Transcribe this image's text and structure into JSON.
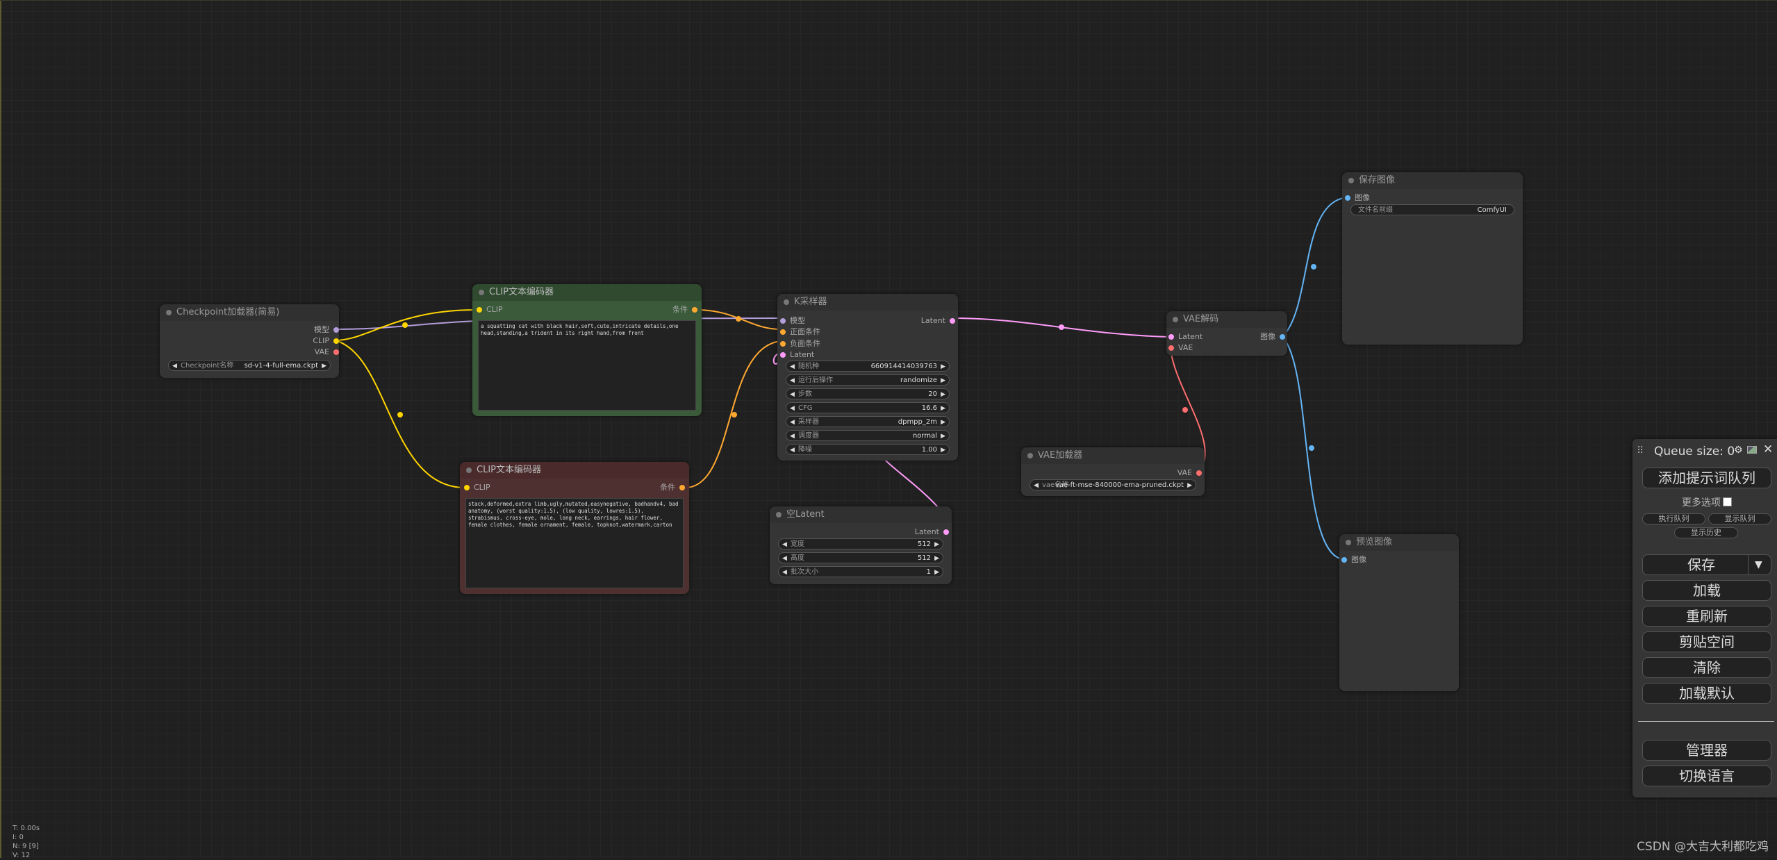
{
  "nodes": {
    "checkpoint": {
      "title": "Checkpoint加载器(简易)",
      "outputs": [
        "模型",
        "CLIP",
        "VAE"
      ],
      "widget_label": "Checkpoint名称",
      "widget_value": "sd-v1-4-full-ema.ckpt"
    },
    "clip_pos": {
      "title": "CLIP文本编码器",
      "input": "CLIP",
      "output": "条件",
      "text": "a squatting cat with black hair,soft,cute,intricate details,one head,standing,a trident in its right hand,from front"
    },
    "clip_neg": {
      "title": "CLIP文本编码器",
      "input": "CLIP",
      "output": "条件",
      "text": "stack,deformed,extra limb,ugly,mutated,easynegative, badhandv4, bad anatomy, (worst quality:1.5), (low quality, lowres:1.5), strabismus, cross-eye, mole, long neck, earrings, hair flower, female clothes, female ornament, female, topknot,watermark,carton"
    },
    "ksampler": {
      "title": "K采样器",
      "inputs": [
        "模型",
        "正面条件",
        "负面条件",
        "Latent"
      ],
      "output": "Latent",
      "widgets": [
        {
          "label": "随机种",
          "value": "660914414039763"
        },
        {
          "label": "运行后操作",
          "value": "randomize"
        },
        {
          "label": "步数",
          "value": "20"
        },
        {
          "label": "CFG",
          "value": "16.6"
        },
        {
          "label": "采样器",
          "value": "dpmpp_2m"
        },
        {
          "label": "调度器",
          "value": "normal"
        },
        {
          "label": "降噪",
          "value": "1.00"
        }
      ]
    },
    "empty_latent": {
      "title": "空Latent",
      "output": "Latent",
      "widgets": [
        {
          "label": "宽度",
          "value": "512"
        },
        {
          "label": "高度",
          "value": "512"
        },
        {
          "label": "批次大小",
          "value": "1"
        }
      ]
    },
    "vae_decode": {
      "title": "VAE解码",
      "inputs": [
        "Latent",
        "VAE"
      ],
      "output": "图像"
    },
    "vae_loader": {
      "title": "VAE加载器",
      "output": "VAE",
      "widget_label": "vae名称",
      "widget_value": "vae-ft-mse-840000-ema-pruned.ckpt"
    },
    "save_image": {
      "title": "保存图像",
      "input": "图像",
      "widget_label": "文件名前缀",
      "widget_value": "ComfyUI"
    },
    "preview_image": {
      "title": "预览图像",
      "input": "图像"
    }
  },
  "colors": {
    "model": "#b39ddb",
    "clip": "#ffd500",
    "vae": "#ff6e6e",
    "conditioning": "#ffa931",
    "latent": "#ff9cf9",
    "image": "#64b5f6"
  },
  "panel": {
    "queue_size": "Queue size: 0",
    "add_queue": "添加提示词队列",
    "more_options": "更多选项",
    "run_queue": "执行队列",
    "show_queue": "显示队列",
    "show_history": "显示历史",
    "save": "保存",
    "load": "加载",
    "refresh": "重刷新",
    "clipspace": "剪贴空间",
    "clear": "清除",
    "load_default": "加载默认",
    "manager": "管理器",
    "switch_lang": "切换语言"
  },
  "stats": [
    "T: 0.00s",
    "I: 0",
    "N: 9 [9]",
    "V: 12"
  ],
  "watermark": "CSDN @大吉大利都吃鸡"
}
